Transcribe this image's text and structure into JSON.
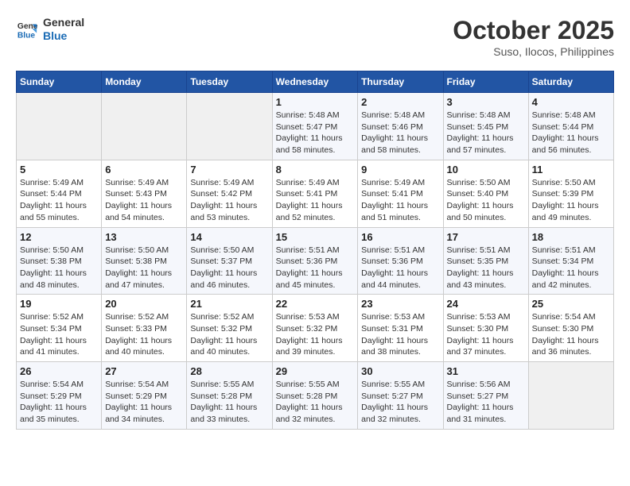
{
  "logo": {
    "line1": "General",
    "line2": "Blue"
  },
  "title": "October 2025",
  "location": "Suso, Ilocos, Philippines",
  "weekdays": [
    "Sunday",
    "Monday",
    "Tuesday",
    "Wednesday",
    "Thursday",
    "Friday",
    "Saturday"
  ],
  "weeks": [
    [
      {
        "day": "",
        "info": ""
      },
      {
        "day": "",
        "info": ""
      },
      {
        "day": "",
        "info": ""
      },
      {
        "day": "1",
        "info": "Sunrise: 5:48 AM\nSunset: 5:47 PM\nDaylight: 11 hours\nand 58 minutes."
      },
      {
        "day": "2",
        "info": "Sunrise: 5:48 AM\nSunset: 5:46 PM\nDaylight: 11 hours\nand 58 minutes."
      },
      {
        "day": "3",
        "info": "Sunrise: 5:48 AM\nSunset: 5:45 PM\nDaylight: 11 hours\nand 57 minutes."
      },
      {
        "day": "4",
        "info": "Sunrise: 5:48 AM\nSunset: 5:44 PM\nDaylight: 11 hours\nand 56 minutes."
      }
    ],
    [
      {
        "day": "5",
        "info": "Sunrise: 5:49 AM\nSunset: 5:44 PM\nDaylight: 11 hours\nand 55 minutes."
      },
      {
        "day": "6",
        "info": "Sunrise: 5:49 AM\nSunset: 5:43 PM\nDaylight: 11 hours\nand 54 minutes."
      },
      {
        "day": "7",
        "info": "Sunrise: 5:49 AM\nSunset: 5:42 PM\nDaylight: 11 hours\nand 53 minutes."
      },
      {
        "day": "8",
        "info": "Sunrise: 5:49 AM\nSunset: 5:41 PM\nDaylight: 11 hours\nand 52 minutes."
      },
      {
        "day": "9",
        "info": "Sunrise: 5:49 AM\nSunset: 5:41 PM\nDaylight: 11 hours\nand 51 minutes."
      },
      {
        "day": "10",
        "info": "Sunrise: 5:50 AM\nSunset: 5:40 PM\nDaylight: 11 hours\nand 50 minutes."
      },
      {
        "day": "11",
        "info": "Sunrise: 5:50 AM\nSunset: 5:39 PM\nDaylight: 11 hours\nand 49 minutes."
      }
    ],
    [
      {
        "day": "12",
        "info": "Sunrise: 5:50 AM\nSunset: 5:38 PM\nDaylight: 11 hours\nand 48 minutes."
      },
      {
        "day": "13",
        "info": "Sunrise: 5:50 AM\nSunset: 5:38 PM\nDaylight: 11 hours\nand 47 minutes."
      },
      {
        "day": "14",
        "info": "Sunrise: 5:50 AM\nSunset: 5:37 PM\nDaylight: 11 hours\nand 46 minutes."
      },
      {
        "day": "15",
        "info": "Sunrise: 5:51 AM\nSunset: 5:36 PM\nDaylight: 11 hours\nand 45 minutes."
      },
      {
        "day": "16",
        "info": "Sunrise: 5:51 AM\nSunset: 5:36 PM\nDaylight: 11 hours\nand 44 minutes."
      },
      {
        "day": "17",
        "info": "Sunrise: 5:51 AM\nSunset: 5:35 PM\nDaylight: 11 hours\nand 43 minutes."
      },
      {
        "day": "18",
        "info": "Sunrise: 5:51 AM\nSunset: 5:34 PM\nDaylight: 11 hours\nand 42 minutes."
      }
    ],
    [
      {
        "day": "19",
        "info": "Sunrise: 5:52 AM\nSunset: 5:34 PM\nDaylight: 11 hours\nand 41 minutes."
      },
      {
        "day": "20",
        "info": "Sunrise: 5:52 AM\nSunset: 5:33 PM\nDaylight: 11 hours\nand 40 minutes."
      },
      {
        "day": "21",
        "info": "Sunrise: 5:52 AM\nSunset: 5:32 PM\nDaylight: 11 hours\nand 40 minutes."
      },
      {
        "day": "22",
        "info": "Sunrise: 5:53 AM\nSunset: 5:32 PM\nDaylight: 11 hours\nand 39 minutes."
      },
      {
        "day": "23",
        "info": "Sunrise: 5:53 AM\nSunset: 5:31 PM\nDaylight: 11 hours\nand 38 minutes."
      },
      {
        "day": "24",
        "info": "Sunrise: 5:53 AM\nSunset: 5:30 PM\nDaylight: 11 hours\nand 37 minutes."
      },
      {
        "day": "25",
        "info": "Sunrise: 5:54 AM\nSunset: 5:30 PM\nDaylight: 11 hours\nand 36 minutes."
      }
    ],
    [
      {
        "day": "26",
        "info": "Sunrise: 5:54 AM\nSunset: 5:29 PM\nDaylight: 11 hours\nand 35 minutes."
      },
      {
        "day": "27",
        "info": "Sunrise: 5:54 AM\nSunset: 5:29 PM\nDaylight: 11 hours\nand 34 minutes."
      },
      {
        "day": "28",
        "info": "Sunrise: 5:55 AM\nSunset: 5:28 PM\nDaylight: 11 hours\nand 33 minutes."
      },
      {
        "day": "29",
        "info": "Sunrise: 5:55 AM\nSunset: 5:28 PM\nDaylight: 11 hours\nand 32 minutes."
      },
      {
        "day": "30",
        "info": "Sunrise: 5:55 AM\nSunset: 5:27 PM\nDaylight: 11 hours\nand 32 minutes."
      },
      {
        "day": "31",
        "info": "Sunrise: 5:56 AM\nSunset: 5:27 PM\nDaylight: 11 hours\nand 31 minutes."
      },
      {
        "day": "",
        "info": ""
      }
    ]
  ]
}
